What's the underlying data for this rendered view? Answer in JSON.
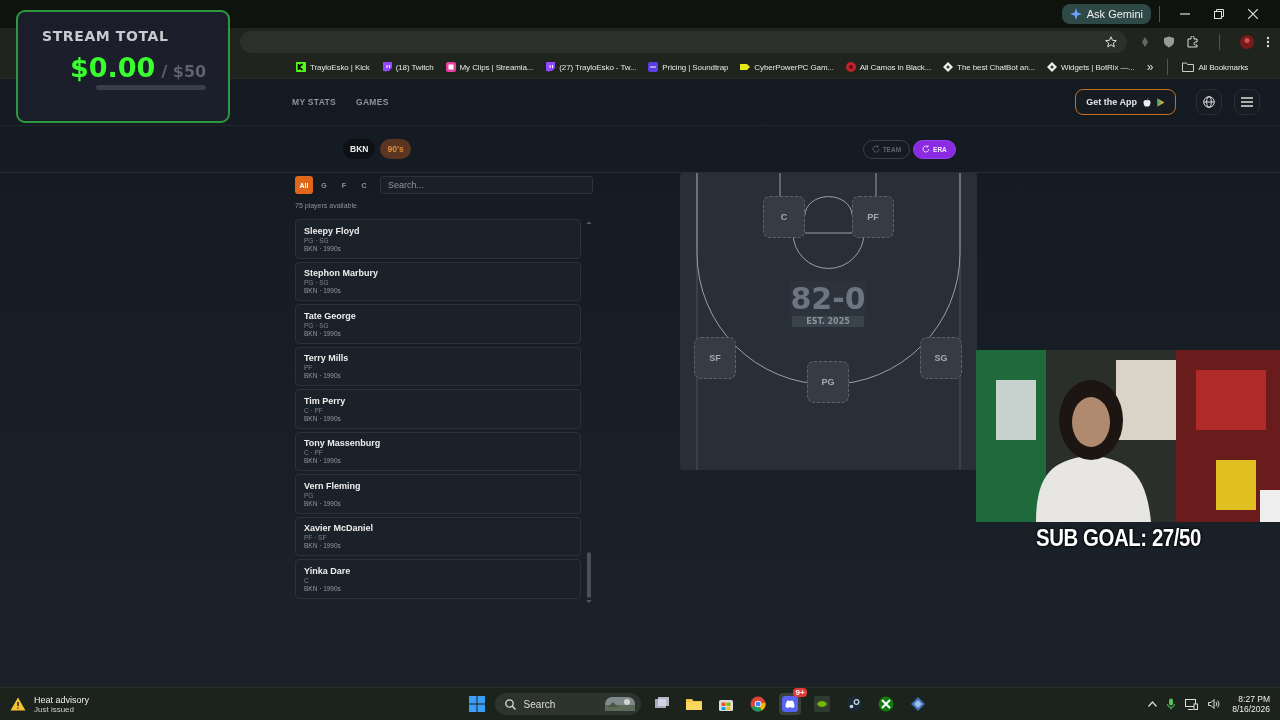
{
  "browser": {
    "ask_gemini": "Ask Gemini",
    "bookmarks": [
      {
        "label": "TrayloEsko | Kick",
        "kind": "kick"
      },
      {
        "label": "(18) Twitch",
        "kind": "twitch"
      },
      {
        "label": "My Clips | Streamla...",
        "kind": "clips"
      },
      {
        "label": "(27) TrayloEsko - Tw...",
        "kind": "twitch"
      },
      {
        "label": "Pricing | Soundtrap",
        "kind": "soundtrap"
      },
      {
        "label": "CyberPowerPC Gam...",
        "kind": "tag"
      },
      {
        "label": "All Camos in Black...",
        "kind": "camo"
      },
      {
        "label": "The best ChatBot an...",
        "kind": "bot"
      },
      {
        "label": "Widgets | BotRix —...",
        "kind": "bot"
      }
    ],
    "more": "»",
    "all_bookmarks": "All Bookmarks"
  },
  "stream_overlay": {
    "title": "STREAM TOTAL",
    "amount": "$0.00",
    "goal": "/ $50",
    "level": 0
  },
  "site": {
    "nav": [
      {
        "label": "MY STATS"
      },
      {
        "label": "GAMES"
      }
    ],
    "get_app": "Get the App"
  },
  "chips": [
    {
      "label": "BKN",
      "kind": "team"
    },
    {
      "label": "90's",
      "kind": "era"
    }
  ],
  "modes": [
    {
      "label": "TEAM",
      "selected": false
    },
    {
      "label": "ERA",
      "selected": true
    }
  ],
  "position_filters": [
    {
      "label": "All",
      "selected": true
    },
    {
      "label": "G",
      "selected": false
    },
    {
      "label": "F",
      "selected": false
    },
    {
      "label": "C",
      "selected": false
    }
  ],
  "search": {
    "placeholder": "Search..."
  },
  "count": "75 players available",
  "players": [
    {
      "name": "Sleepy Floyd",
      "positions": "PG · SG",
      "team_era": "BKN · 1990s"
    },
    {
      "name": "Stephon Marbury",
      "positions": "PG · SG",
      "team_era": "BKN · 1990s"
    },
    {
      "name": "Tate George",
      "positions": "PG · SG",
      "team_era": "BKN · 1990s"
    },
    {
      "name": "Terry Mills",
      "positions": "PF",
      "team_era": "BKN · 1990s"
    },
    {
      "name": "Tim Perry",
      "positions": "C · PF",
      "team_era": "BKN · 1990s"
    },
    {
      "name": "Tony Massenburg",
      "positions": "C · PF",
      "team_era": "BKN · 1990s"
    },
    {
      "name": "Vern Fleming",
      "positions": "PG",
      "team_era": "BKN · 1990s"
    },
    {
      "name": "Xavier McDaniel",
      "positions": "PF · SF",
      "team_era": "BKN · 1990s"
    },
    {
      "name": "Yinka Dare",
      "positions": "C",
      "team_era": "BKN · 1990s"
    }
  ],
  "court": {
    "logo": "82-0",
    "est": "EST. 2025",
    "slots": [
      {
        "label": "C"
      },
      {
        "label": "PF"
      },
      {
        "label": "SF"
      },
      {
        "label": "PG"
      },
      {
        "label": "SG"
      }
    ]
  },
  "sub_goal": "SUB GOAL: 27/50",
  "taskbar": {
    "weather": {
      "title": "Heat advisory",
      "subtitle": "Just issued"
    },
    "search_label": "Search",
    "apps": [
      {
        "kind": "taskview"
      },
      {
        "kind": "folder"
      },
      {
        "kind": "store"
      },
      {
        "kind": "chrome"
      },
      {
        "kind": "discord",
        "badge": "9+"
      },
      {
        "kind": "nvidia"
      },
      {
        "kind": "steam"
      },
      {
        "kind": "xbox"
      },
      {
        "kind": "app"
      }
    ],
    "time": "8:27 PM",
    "date": "8/16/2026"
  }
}
